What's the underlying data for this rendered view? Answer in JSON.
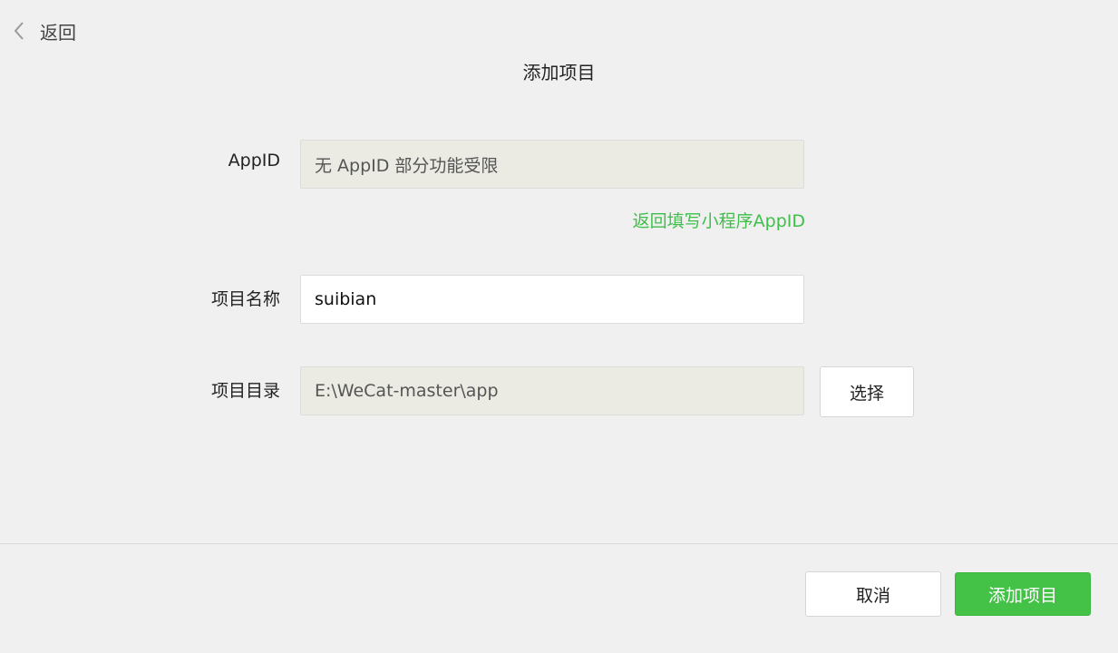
{
  "header": {
    "back_label": "返回",
    "back_icon": "chevron-left-icon",
    "title": "添加项目"
  },
  "form": {
    "appid": {
      "label": "AppID",
      "value": "无 AppID 部分功能受限",
      "link": "返回填写小程序AppID"
    },
    "project_name": {
      "label": "项目名称",
      "value": "suibian"
    },
    "project_dir": {
      "label": "项目目录",
      "value": "E:\\WeCat-master\\app",
      "select_label": "选择"
    }
  },
  "footer": {
    "cancel_label": "取消",
    "submit_label": "添加项目"
  },
  "colors": {
    "background": "#f0f0f0",
    "accent": "#44c248",
    "link": "#3fbf4a",
    "readonly_field": "#ebebe4"
  }
}
